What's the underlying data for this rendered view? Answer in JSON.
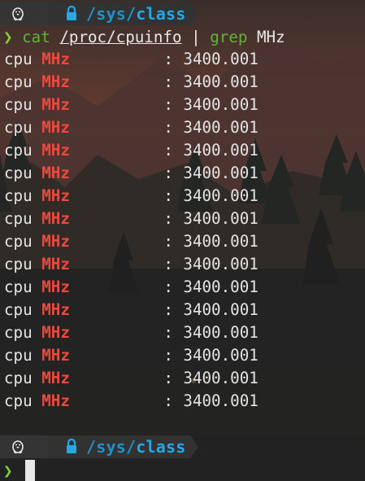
{
  "prompt": {
    "os_icon": "linux-tux-icon",
    "lock_icon": "lock-icon",
    "path_prefix": "/",
    "path_dir1": "sys",
    "path_sep": "/",
    "path_dir2": "class"
  },
  "command": {
    "chevron": "❯",
    "program": "cat",
    "argument": "/proc/cpuinfo",
    "pipe": "|",
    "program2": "grep",
    "pattern": "MHz"
  },
  "output": {
    "rows": [
      {
        "label": "cpu",
        "highlight": "MHz",
        "colon": ":",
        "value": "3400.001"
      },
      {
        "label": "cpu",
        "highlight": "MHz",
        "colon": ":",
        "value": "3400.001"
      },
      {
        "label": "cpu",
        "highlight": "MHz",
        "colon": ":",
        "value": "3400.001"
      },
      {
        "label": "cpu",
        "highlight": "MHz",
        "colon": ":",
        "value": "3400.001"
      },
      {
        "label": "cpu",
        "highlight": "MHz",
        "colon": ":",
        "value": "3400.001"
      },
      {
        "label": "cpu",
        "highlight": "MHz",
        "colon": ":",
        "value": "3400.001"
      },
      {
        "label": "cpu",
        "highlight": "MHz",
        "colon": ":",
        "value": "3400.001"
      },
      {
        "label": "cpu",
        "highlight": "MHz",
        "colon": ":",
        "value": "3400.001"
      },
      {
        "label": "cpu",
        "highlight": "MHz",
        "colon": ":",
        "value": "3400.001"
      },
      {
        "label": "cpu",
        "highlight": "MHz",
        "colon": ":",
        "value": "3400.001"
      },
      {
        "label": "cpu",
        "highlight": "MHz",
        "colon": ":",
        "value": "3400.001"
      },
      {
        "label": "cpu",
        "highlight": "MHz",
        "colon": ":",
        "value": "3400.001"
      },
      {
        "label": "cpu",
        "highlight": "MHz",
        "colon": ":",
        "value": "3400.001"
      },
      {
        "label": "cpu",
        "highlight": "MHz",
        "colon": ":",
        "value": "3400.001"
      },
      {
        "label": "cpu",
        "highlight": "MHz",
        "colon": ":",
        "value": "3400.001"
      },
      {
        "label": "cpu",
        "highlight": "MHz",
        "colon": ":",
        "value": "3400.001"
      }
    ]
  },
  "prompt2": {
    "chevron": "❯"
  },
  "colors": {
    "background": "#2a2826",
    "segment": "#343434",
    "path_blue": "#23a8e8",
    "chevron_green": "#7fd137",
    "command_green": "#5fb336",
    "highlight_red": "#f0483c"
  }
}
